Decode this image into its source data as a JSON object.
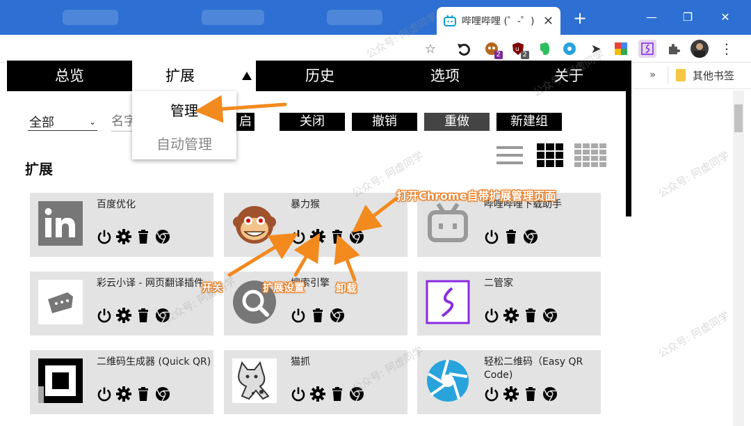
{
  "browser": {
    "tab_title": "哔哩哔哩 (゜-゜)",
    "tab_close": "✕",
    "new_tab": "+",
    "window_minimize": "—",
    "window_restore": "❐",
    "window_close": "✕",
    "toolbar_badges": {
      "tampermonkey": "2",
      "ublock": "2"
    },
    "bookmark_overflow": "»",
    "bookmark_other": "其他书签"
  },
  "nav": {
    "items": [
      "总览",
      "扩展",
      "历史",
      "选项",
      "关于"
    ],
    "active": "扩展",
    "dropdown": [
      "管理",
      "自动管理"
    ]
  },
  "filters": {
    "scope": "全部",
    "search_placeholder": "名字"
  },
  "actions": {
    "open": "启",
    "close": "关闭",
    "undo": "撤销",
    "redo": "重做",
    "new_group": "新建组"
  },
  "section_title": "扩展",
  "extensions": [
    {
      "name": "百度优化",
      "logo": "linkedin-icon"
    },
    {
      "name": "暴力猴",
      "logo": "monkey-icon"
    },
    {
      "name": "哔哩哔哩下载助手",
      "logo": "bilibili-icon"
    },
    {
      "name": "彩云小译 - 网页翻译插件",
      "logo": "caiyun-icon"
    },
    {
      "name": "搜索引擎",
      "logo": "magnifier-icon"
    },
    {
      "name": "二管家",
      "logo": "erguanjia-icon"
    },
    {
      "name": "二维码生成器 (Quick QR)",
      "logo": "qr-icon"
    },
    {
      "name": "猫抓",
      "logo": "cat-icon"
    },
    {
      "name": "轻松二维码（Easy QR Code)",
      "logo": "aperture-icon"
    }
  ],
  "annotations": {
    "open_chrome_ext_page": "打开Chrome自带扩展管理页面",
    "toggle": "开关",
    "settings": "扩展设置",
    "uninstall": "卸载"
  },
  "watermark": "公众号: 阿虚同学",
  "colors": {
    "accent": "#f28a1e",
    "chrome_blue": "#2d6fd2",
    "card_bg": "#e3e3e3"
  }
}
